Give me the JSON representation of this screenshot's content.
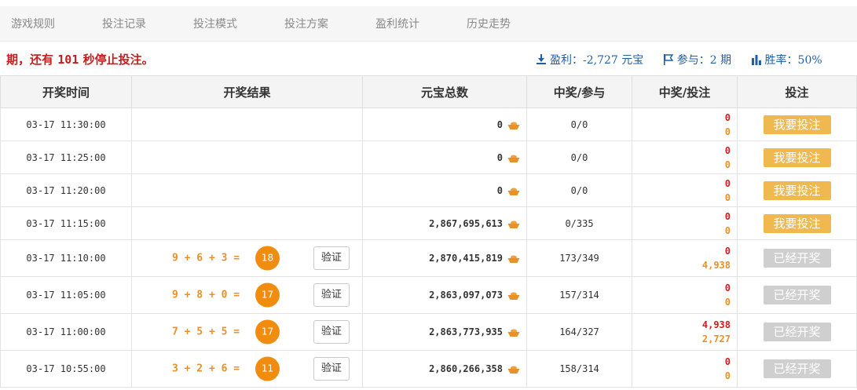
{
  "nav": {
    "items": [
      "游戏规则",
      "投注记录",
      "投注模式",
      "投注方案",
      "盈利统计",
      "历史走势"
    ]
  },
  "info": {
    "countdown_prefix": "期，还有",
    "countdown_seconds": "101",
    "countdown_suffix": "秒停止投注。",
    "profit": "盈利：-2,727 元宝",
    "participation": "参与：2 期",
    "winrate": "胜率：50%"
  },
  "table": {
    "headers": [
      "开奖时间",
      "开奖结果",
      "元宝总数",
      "中奖/参与",
      "中奖/投注",
      "投注"
    ],
    "verify_label": "验证",
    "bet_label": "我要投注",
    "done_label": "已经开奖",
    "rows": [
      {
        "time": "03-17 11:30:00",
        "formula": "",
        "sum": "",
        "total": "0",
        "ratio": "0/0",
        "win_top": "0",
        "win_bottom": "0",
        "status": "bet"
      },
      {
        "time": "03-17 11:25:00",
        "formula": "",
        "sum": "",
        "total": "0",
        "ratio": "0/0",
        "win_top": "0",
        "win_bottom": "0",
        "status": "bet"
      },
      {
        "time": "03-17 11:20:00",
        "formula": "",
        "sum": "",
        "total": "0",
        "ratio": "0/0",
        "win_top": "0",
        "win_bottom": "0",
        "status": "bet"
      },
      {
        "time": "03-17 11:15:00",
        "formula": "",
        "sum": "",
        "total": "2,867,695,613",
        "ratio": "0/335",
        "win_top": "0",
        "win_bottom": "0",
        "status": "bet"
      },
      {
        "time": "03-17 11:10:00",
        "formula": "9 + 6 + 3 =",
        "sum": "18",
        "total": "2,870,415,819",
        "ratio": "173/349",
        "win_top": "0",
        "win_bottom": "4,938",
        "status": "done"
      },
      {
        "time": "03-17 11:05:00",
        "formula": "9 + 8 + 0 =",
        "sum": "17",
        "total": "2,863,097,073",
        "ratio": "157/314",
        "win_top": "0",
        "win_bottom": "0",
        "status": "done"
      },
      {
        "time": "03-17 11:00:00",
        "formula": "7 + 5 + 5 =",
        "sum": "17",
        "total": "2,863,773,935",
        "ratio": "164/327",
        "win_top": "4,938",
        "win_bottom": "2,727",
        "status": "done"
      },
      {
        "time": "03-17 10:55:00",
        "formula": "3 + 2 + 6 =",
        "sum": "11",
        "total": "2,860,266,358",
        "ratio": "158/314",
        "win_top": "0",
        "win_bottom": "0",
        "status": "done"
      }
    ],
    "row_heights": [
      42,
      42,
      42,
      42,
      47,
      47,
      47,
      47
    ]
  },
  "colors": {
    "accent_orange": "#e8902a",
    "ball_orange": "#f28c0f",
    "bet_button": "#f0b94f",
    "done_button": "#cfcfcf",
    "alert_red": "#c81d1d",
    "stat_blue": "#1f5fa8"
  }
}
